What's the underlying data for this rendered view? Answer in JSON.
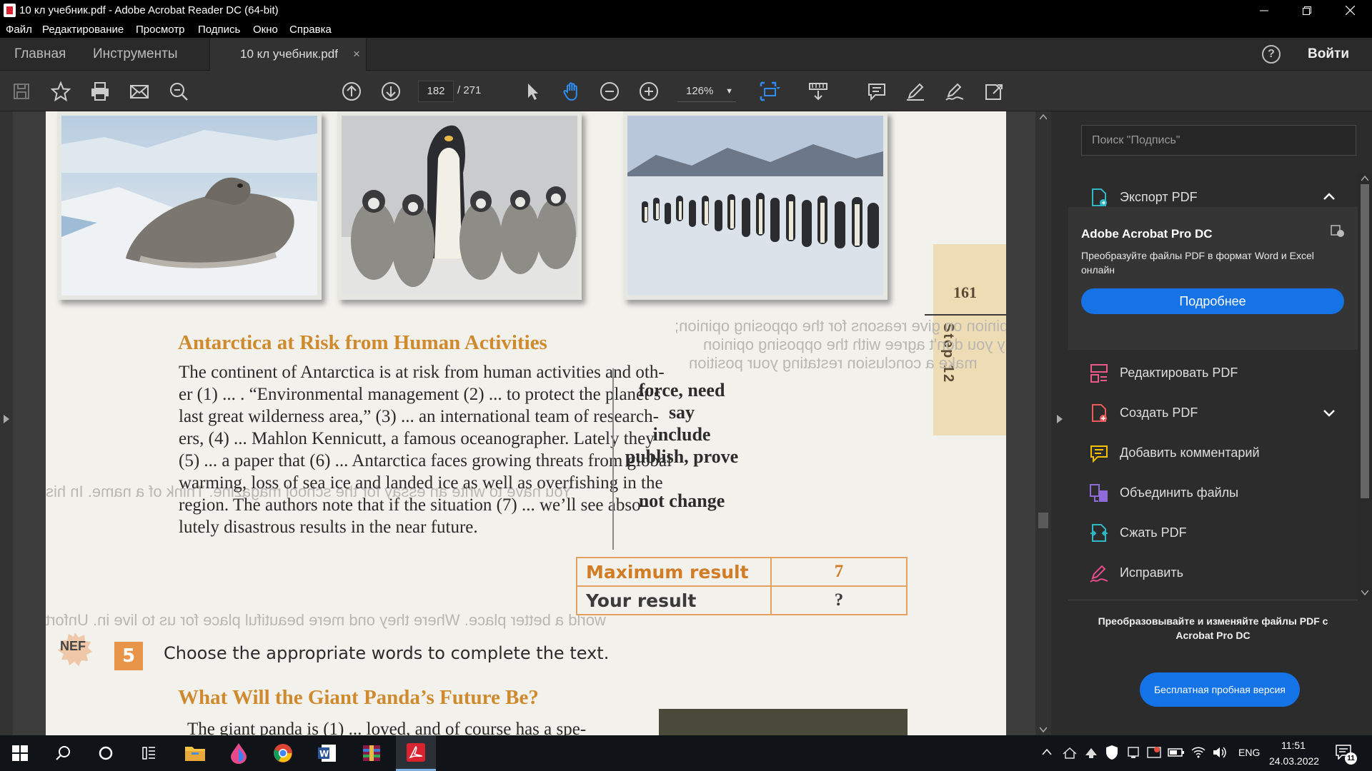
{
  "window": {
    "title": "10 кл учебник.pdf - Adobe Acrobat Reader DC (64-bit)",
    "controls": [
      "minimize",
      "restore",
      "close"
    ]
  },
  "menu": {
    "items": [
      "Файл",
      "Редактирование",
      "Просмотр",
      "Подпись",
      "Окно",
      "Справка"
    ]
  },
  "tabs": {
    "home": "Главная",
    "tools": "Инструменты",
    "document": "10 кл учебник.pdf",
    "close": "×",
    "help": "?",
    "signin": "Войти"
  },
  "toolbar": {
    "page_current": "182",
    "page_total": "/ 271",
    "zoom": "126%"
  },
  "document": {
    "page_tab": {
      "number": "161",
      "step": "Step 12"
    },
    "heading1": "Antarctica at Risk from Human Activities",
    "paragraph_lines": [
      "The continent of Antarctica is at risk from human activities and oth-",
      "er (1) ... . “Environmental management (2) ... to protect the planet’s",
      "last great wilderness area,” (3) ... an international team of research-",
      "ers, (4) ... Mahlon Kennicutt, a famous oceanographer. Lately they",
      "(5) ... a paper that (6) ... Antarctica faces growing threats from global",
      "warming, loss of sea ice and landed ice as well as overfishing in the",
      "region. The authors note that if the situation (7) ... we’ll see abso-",
      "lutely disastrous results in the near future."
    ],
    "word_box": [
      "force, need",
      "say",
      "include",
      "publish, prove",
      "",
      "not change"
    ],
    "result_table": [
      {
        "label": "Maximum result",
        "value": "7"
      },
      {
        "label": "Your result",
        "value": "?"
      }
    ],
    "task_badge": "NEF",
    "task_number": "5",
    "task_text": "Choose the appropriate words to complete the text.",
    "heading2": "What Will the Giant Panda’s Future Be?",
    "last_line": "The giant panda is (1) ... loved, and of course has a spe-"
  },
  "right_panel": {
    "search_placeholder": "Поиск \"Подпись\"",
    "export_label": "Экспорт PDF",
    "promo_title": "Adobe Acrobat Pro DC",
    "promo_desc": "Преобразуйте файлы PDF в формат Word и Excel онлайн",
    "promo_button": "Подробнее",
    "tools": [
      {
        "label": "Редактировать PDF",
        "icon": "edit-pdf-icon",
        "color": "#ec5a8c"
      },
      {
        "label": "Создать PDF",
        "icon": "create-pdf-icon",
        "color": "#ec5a5a"
      },
      {
        "label": "Добавить комментарий",
        "icon": "comment-icon",
        "color": "#f2c200"
      },
      {
        "label": "Объединить файлы",
        "icon": "combine-icon",
        "color": "#8e6bd8"
      },
      {
        "label": "Сжать PDF",
        "icon": "compress-icon",
        "color": "#2fb8c6"
      },
      {
        "label": "Исправить",
        "icon": "fill-sign-icon",
        "color": "#e74b8c"
      }
    ],
    "bottom_text": "Преобразовывайте и изменяйте файлы PDF с Acrobat Pro DC",
    "trial_button": "Бесплатная пробная версия"
  },
  "taskbar": {
    "lang": "ENG",
    "time": "11:51",
    "date": "24.03.2022",
    "notifications": "11"
  },
  "colors": {
    "accent_blue": "#1473e6",
    "heading_orange": "#d08a2e",
    "table_border": "#e3a25f"
  }
}
